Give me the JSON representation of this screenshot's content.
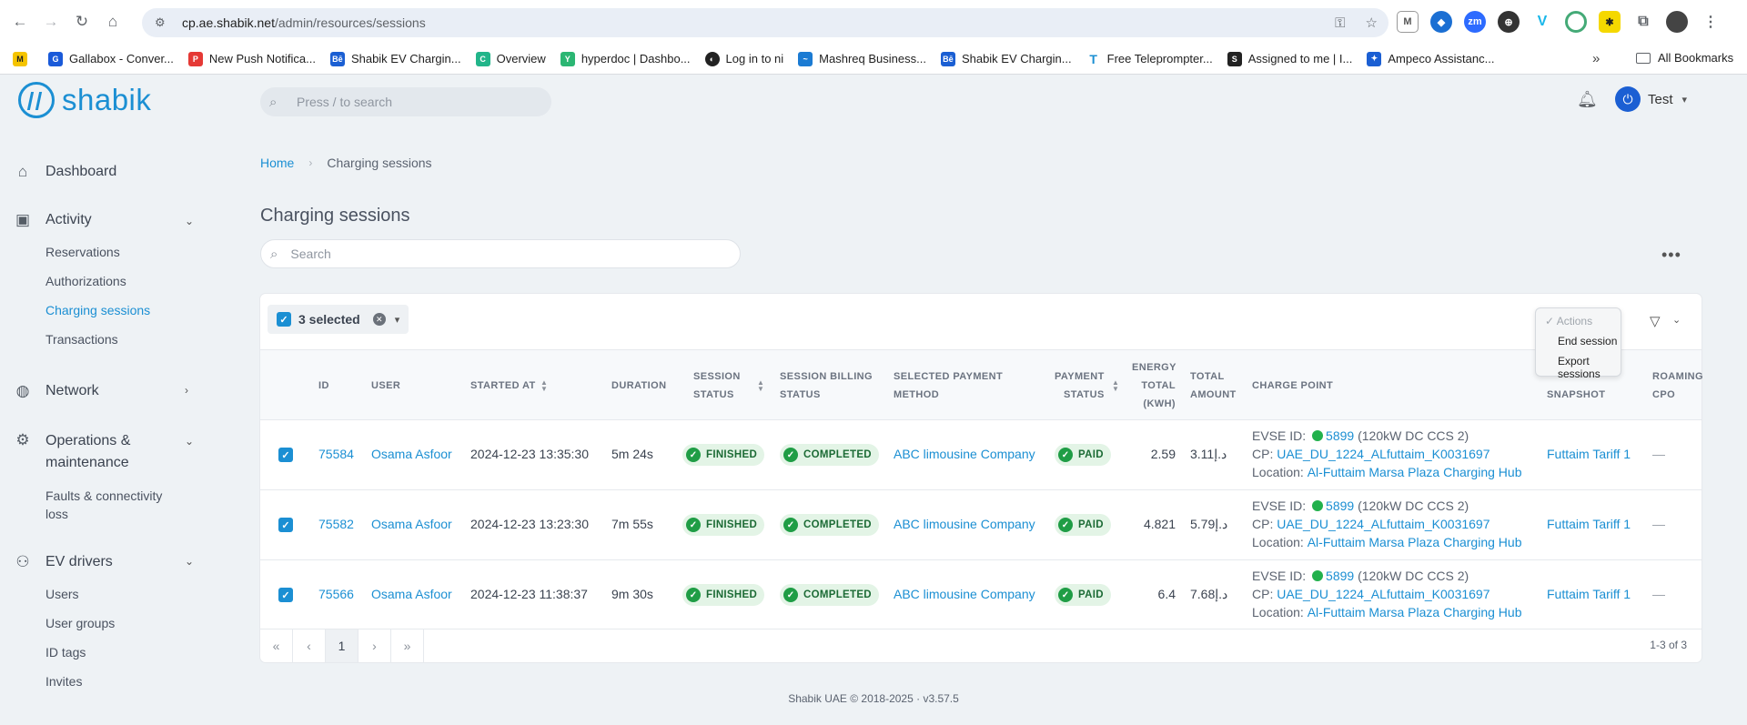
{
  "browser": {
    "url_host": "cp.ae.shabik.net",
    "url_path": "/admin/resources/sessions",
    "bookmarks": [
      {
        "label": "Gallabox - Conver...",
        "color": "#1a5ad9"
      },
      {
        "label": "New Push Notifica...",
        "color": "#e53935"
      },
      {
        "label": "Shabik EV Chargin...",
        "color": "#1b5fd3"
      },
      {
        "label": "Overview",
        "color": "#22b58a"
      },
      {
        "label": "hyperdoc | Dashbo...",
        "color": "#2bb673"
      },
      {
        "label": "Log in to ni",
        "color": "#222222"
      },
      {
        "label": "Mashreq Business...",
        "color": "#1b7bd3"
      },
      {
        "label": "Shabik EV Chargin...",
        "color": "#1b5fd3"
      },
      {
        "label": "Free Teleprompter...",
        "color": "#1b8fd3"
      },
      {
        "label": "Assigned to me | I...",
        "color": "#222222"
      },
      {
        "label": "Ampeco Assistanc...",
        "color": "#1b5fd3"
      }
    ],
    "bookmarks_more": "»",
    "all_bookmarks": "All Bookmarks"
  },
  "header": {
    "logo_text": "shabik",
    "search_placeholder": "Press / to search",
    "user_name": "Test"
  },
  "sidebar": {
    "dashboard": "Dashboard",
    "activity": "Activity",
    "activity_items": [
      "Reservations",
      "Authorizations",
      "Charging sessions",
      "Transactions"
    ],
    "network": "Network",
    "operations_line1": "Operations &",
    "operations_line2": "maintenance",
    "operations_items_line1": "Faults & connectivity",
    "operations_items_line2": "loss",
    "ev_drivers": "EV drivers",
    "ev_items": [
      "Users",
      "User groups",
      "ID tags",
      "Invites"
    ]
  },
  "main": {
    "breadcrumb_home": "Home",
    "breadcrumb_current": "Charging sessions",
    "title": "Charging sessions",
    "search_placeholder": "Search",
    "selected_label": "3 selected",
    "columns": {
      "id": "ID",
      "user": "USER",
      "started_at": "STARTED AT",
      "duration": "DURATION",
      "session_status_1": "SESSION",
      "session_status_2": "STATUS",
      "billing_1": "SESSION BILLING",
      "billing_2": "STATUS",
      "payment_method_1": "SELECTED PAYMENT",
      "payment_method_2": "METHOD",
      "payment_status_1": "PAYMENT",
      "payment_status_2": "STATUS",
      "energy_1": "ENERGY",
      "energy_2": "TOTAL",
      "energy_3": "(KWH)",
      "total_1": "TOTAL",
      "total_2": "AMOUNT",
      "charge_point": "CHARGE POINT",
      "tariff_2": "SNAPSHOT",
      "roaming_1": "ROAMING",
      "roaming_2": "CPO"
    },
    "rows": [
      {
        "id": "75584",
        "user": "Osama Asfoor",
        "started": "2024-12-23 13:35:30",
        "duration": "5m 24s",
        "session_status": "FINISHED",
        "billing_status": "COMPLETED",
        "payment_method": "ABC limousine Company",
        "payment_status": "PAID",
        "energy": "2.59",
        "amount": "3.11د.إ",
        "evse_label": "EVSE ID:",
        "evse_id": "5899",
        "evse_desc": "(120kW DC CCS 2)",
        "cp_label": "CP:",
        "cp": "UAE_DU_1224_ALfuttaim_K0031697",
        "loc_label": "Location:",
        "location": "Al-Futtaim Marsa Plaza Charging Hub",
        "tariff": "Futtaim Tariff 1",
        "roaming": "—"
      },
      {
        "id": "75582",
        "user": "Osama Asfoor",
        "started": "2024-12-23 13:23:30",
        "duration": "7m 55s",
        "session_status": "FINISHED",
        "billing_status": "COMPLETED",
        "payment_method": "ABC limousine Company",
        "payment_status": "PAID",
        "energy": "4.821",
        "amount": "5.79د.إ",
        "evse_label": "EVSE ID:",
        "evse_id": "5899",
        "evse_desc": "(120kW DC CCS 2)",
        "cp_label": "CP:",
        "cp": "UAE_DU_1224_ALfuttaim_K0031697",
        "loc_label": "Location:",
        "location": "Al-Futtaim Marsa Plaza Charging Hub",
        "tariff": "Futtaim Tariff 1",
        "roaming": "—"
      },
      {
        "id": "75566",
        "user": "Osama Asfoor",
        "started": "2024-12-23 11:38:37",
        "duration": "9m 30s",
        "session_status": "FINISHED",
        "billing_status": "COMPLETED",
        "payment_method": "ABC limousine Company",
        "payment_status": "PAID",
        "energy": "6.4",
        "amount": "7.68د.إ",
        "evse_label": "EVSE ID:",
        "evse_id": "5899",
        "evse_desc": "(120kW DC CCS 2)",
        "cp_label": "CP:",
        "cp": "UAE_DU_1224_ALfuttaim_K0031697",
        "loc_label": "Location:",
        "location": "Al-Futtaim Marsa Plaza Charging Hub",
        "tariff": "Futtaim Tariff 1",
        "roaming": "—"
      }
    ],
    "pagination": {
      "first": "«",
      "prev": "‹",
      "page": "1",
      "next": "›",
      "last": "»",
      "count": "1-3 of 3"
    },
    "actions_menu": {
      "header": "Actions",
      "items": [
        "End session",
        "Export sessions"
      ]
    }
  },
  "footer": "Shabik UAE © 2018-2025 · v3.57.5",
  "colors": {
    "accent": "#1b8fd3",
    "success": "#1f9d45",
    "badge_bg": "#e3f4e6"
  }
}
